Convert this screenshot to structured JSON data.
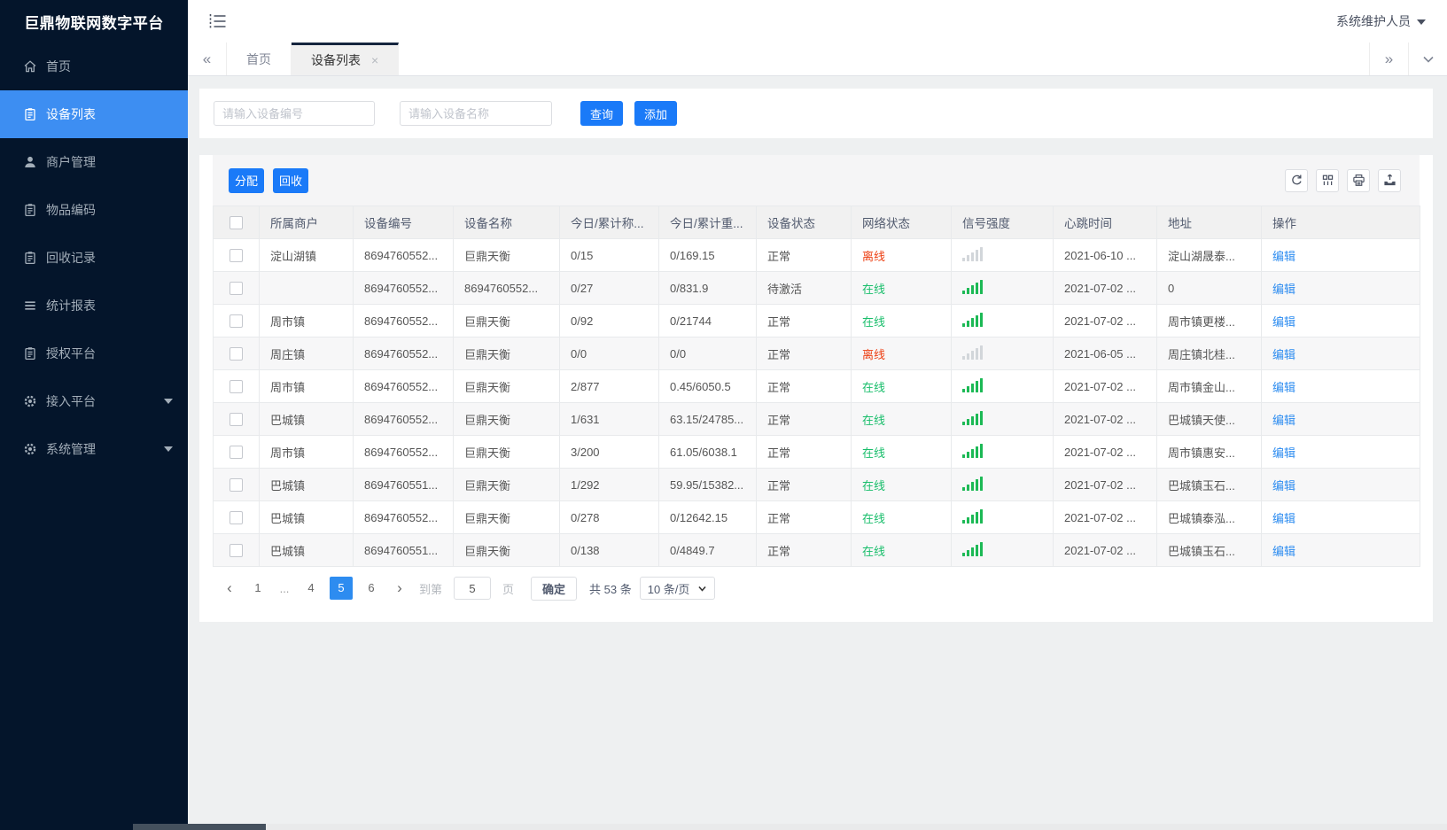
{
  "app": {
    "title": "巨鼎物联网数字平台",
    "user": "系统维护人员"
  },
  "sidebar": {
    "items": [
      {
        "id": "home",
        "label": "首页",
        "icon": "home-icon",
        "active": false,
        "caret": false
      },
      {
        "id": "device-list",
        "label": "设备列表",
        "icon": "clipboard-icon",
        "active": true,
        "caret": false
      },
      {
        "id": "merchant-mgmt",
        "label": "商户管理",
        "icon": "user-icon",
        "active": false,
        "caret": false
      },
      {
        "id": "item-code",
        "label": "物品编码",
        "icon": "clipboard-icon",
        "active": false,
        "caret": false
      },
      {
        "id": "recycle-records",
        "label": "回收记录",
        "icon": "clipboard-icon",
        "active": false,
        "caret": false
      },
      {
        "id": "stats-report",
        "label": "统计报表",
        "icon": "lines-icon",
        "active": false,
        "caret": false
      },
      {
        "id": "auth-platform",
        "label": "授权平台",
        "icon": "clipboard-icon",
        "active": false,
        "caret": false
      },
      {
        "id": "access-platform",
        "label": "接入平台",
        "icon": "gear-icon",
        "active": false,
        "caret": true
      },
      {
        "id": "system-mgmt",
        "label": "系统管理",
        "icon": "gear-icon",
        "active": false,
        "caret": true
      }
    ]
  },
  "tabs": {
    "scroll_left": "«",
    "scroll_right": "»",
    "items": [
      {
        "id": "home",
        "label": "首页",
        "active": false,
        "closable": false
      },
      {
        "id": "device-list",
        "label": "设备列表",
        "active": true,
        "closable": true
      }
    ],
    "close_glyph": "×"
  },
  "search": {
    "device_no_placeholder": "请输入设备编号",
    "device_name_placeholder": "请输入设备名称",
    "query_label": "查询",
    "add_label": "添加"
  },
  "toolbar": {
    "assign_label": "分配",
    "recycle_label": "回收",
    "icons": [
      "refresh",
      "columns",
      "print",
      "export"
    ]
  },
  "table": {
    "columns": [
      "所属商户",
      "设备编号",
      "设备名称",
      "今日/累计称...",
      "今日/累计重...",
      "设备状态",
      "网络状态",
      "信号强度",
      "心跳时间",
      "地址",
      "操作"
    ],
    "rows": [
      {
        "merchant": "淀山湖镇",
        "device_no": "8694760552...",
        "device_name": "巨鼎天衡",
        "today_count": "0/15",
        "today_weight": "0/169.15",
        "device_status": "正常",
        "network_status": "离线",
        "online": false,
        "signal": "weak",
        "heartbeat": "2021-06-10 ...",
        "address": "淀山湖晟泰...",
        "action": "编辑"
      },
      {
        "merchant": "",
        "device_no": "8694760552...",
        "device_name": "8694760552...",
        "today_count": "0/27",
        "today_weight": "0/831.9",
        "device_status": "待激活",
        "network_status": "在线",
        "online": true,
        "signal": "strong",
        "heartbeat": "2021-07-02 ...",
        "address": "0",
        "action": "编辑"
      },
      {
        "merchant": "周市镇",
        "device_no": "8694760552...",
        "device_name": "巨鼎天衡",
        "today_count": "0/92",
        "today_weight": "0/21744",
        "device_status": "正常",
        "network_status": "在线",
        "online": true,
        "signal": "strong",
        "heartbeat": "2021-07-02 ...",
        "address": "周市镇更楼...",
        "action": "编辑"
      },
      {
        "merchant": "周庄镇",
        "device_no": "8694760552...",
        "device_name": "巨鼎天衡",
        "today_count": "0/0",
        "today_weight": "0/0",
        "device_status": "正常",
        "network_status": "离线",
        "online": false,
        "signal": "weak",
        "heartbeat": "2021-06-05 ...",
        "address": "周庄镇北桂...",
        "action": "编辑"
      },
      {
        "merchant": "周市镇",
        "device_no": "8694760552...",
        "device_name": "巨鼎天衡",
        "today_count": "2/877",
        "today_weight": "0.45/6050.5",
        "device_status": "正常",
        "network_status": "在线",
        "online": true,
        "signal": "strong",
        "heartbeat": "2021-07-02 ...",
        "address": "周市镇金山...",
        "action": "编辑"
      },
      {
        "merchant": "巴城镇",
        "device_no": "8694760552...",
        "device_name": "巨鼎天衡",
        "today_count": "1/631",
        "today_weight": "63.15/24785...",
        "device_status": "正常",
        "network_status": "在线",
        "online": true,
        "signal": "strong",
        "heartbeat": "2021-07-02 ...",
        "address": "巴城镇天使...",
        "action": "编辑"
      },
      {
        "merchant": "周市镇",
        "device_no": "8694760552...",
        "device_name": "巨鼎天衡",
        "today_count": "3/200",
        "today_weight": "61.05/6038.1",
        "device_status": "正常",
        "network_status": "在线",
        "online": true,
        "signal": "strong",
        "heartbeat": "2021-07-02 ...",
        "address": "周市镇惠安...",
        "action": "编辑"
      },
      {
        "merchant": "巴城镇",
        "device_no": "8694760551...",
        "device_name": "巨鼎天衡",
        "today_count": "1/292",
        "today_weight": "59.95/15382...",
        "device_status": "正常",
        "network_status": "在线",
        "online": true,
        "signal": "strong",
        "heartbeat": "2021-07-02 ...",
        "address": "巴城镇玉石...",
        "action": "编辑"
      },
      {
        "merchant": "巴城镇",
        "device_no": "8694760552...",
        "device_name": "巨鼎天衡",
        "today_count": "0/278",
        "today_weight": "0/12642.15",
        "device_status": "正常",
        "network_status": "在线",
        "online": true,
        "signal": "strong",
        "heartbeat": "2021-07-02 ...",
        "address": "巴城镇泰泓...",
        "action": "编辑"
      },
      {
        "merchant": "巴城镇",
        "device_no": "8694760551...",
        "device_name": "巨鼎天衡",
        "today_count": "0/138",
        "today_weight": "0/4849.7",
        "device_status": "正常",
        "network_status": "在线",
        "online": true,
        "signal": "strong",
        "heartbeat": "2021-07-02 ...",
        "address": "巴城镇玉石...",
        "action": "编辑"
      }
    ]
  },
  "pagination": {
    "prev_glyph": "‹",
    "next_glyph": "›",
    "pages": [
      {
        "label": "1",
        "type": "page"
      },
      {
        "label": "...",
        "type": "ellipsis"
      },
      {
        "label": "4",
        "type": "page"
      },
      {
        "label": "5",
        "type": "page",
        "active": true
      },
      {
        "label": "6",
        "type": "page"
      }
    ],
    "goto_prefix": "到第",
    "goto_value": "5",
    "goto_suffix": "页",
    "confirm_label": "确定",
    "total_text": "共 53 条",
    "page_size_value": "10 条/页"
  },
  "colors": {
    "online_green": "#19be6b",
    "offline_red": "#ed4014",
    "link_blue": "#2d8cf0",
    "signal_green": "#1cb955",
    "signal_gray": "#d2d6da",
    "primary_button": "#1a7af8",
    "sidebar_bg": "#04152b",
    "sidebar_active": "#3d8ef2"
  }
}
